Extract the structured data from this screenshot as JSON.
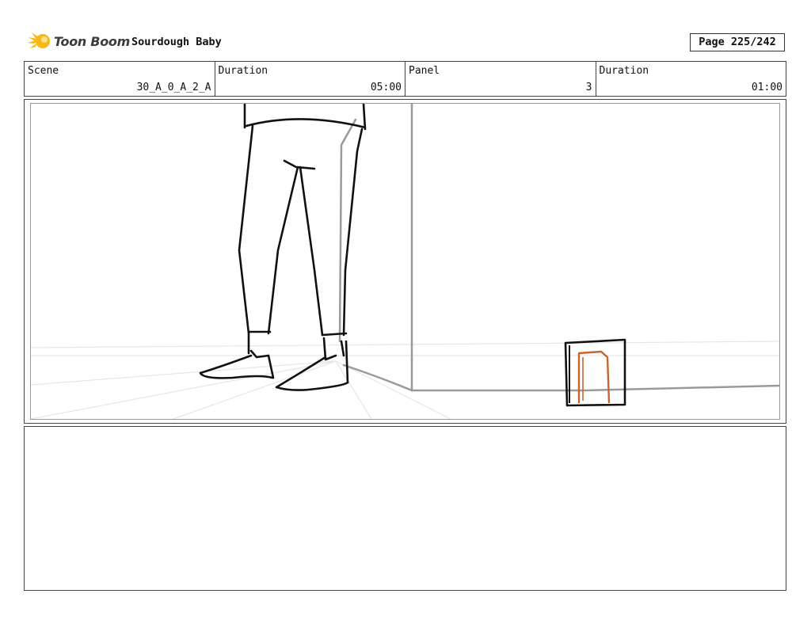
{
  "header": {
    "logo_text": "Toon Boom",
    "project_title": "Sourdough Baby",
    "page_label": "Page 225/242"
  },
  "info": {
    "scene_label": "Scene",
    "scene_value": "30_A_0_A_2_A",
    "duration_label": "Duration",
    "duration_value": "05:00",
    "panel_label": "Panel",
    "panel_value": "3",
    "panel_duration_label": "Duration",
    "panel_duration_value": "01:00"
  },
  "notes": {
    "text": ""
  },
  "colors": {
    "logo_accent": "#f5b915",
    "sketch_line": "#111111",
    "guide_line": "#9a9a9a",
    "perspective_line": "#e6e6e6",
    "door_color": "#c8652a"
  }
}
